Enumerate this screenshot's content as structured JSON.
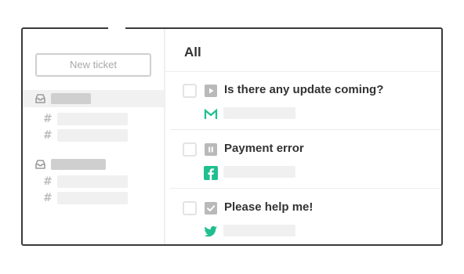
{
  "sidebar": {
    "new_ticket_label": "New ticket",
    "inboxes": [
      {
        "icon": "inbox-icon",
        "active": true,
        "channels": 2
      },
      {
        "icon": "inbox-icon",
        "active": false,
        "channels": 2
      }
    ]
  },
  "main": {
    "title": "All",
    "tickets": [
      {
        "subject": "Is there any update coming?",
        "status_icon": "play-icon",
        "channel_icon": "gmail-icon",
        "channel_color": "#1fbf8f"
      },
      {
        "subject": "Payment error",
        "status_icon": "pause-icon",
        "channel_icon": "facebook-icon",
        "channel_color": "#1fbf8f"
      },
      {
        "subject": "Please help me!",
        "status_icon": "check-icon",
        "channel_icon": "twitter-icon",
        "channel_color": "#1fbf8f"
      }
    ]
  },
  "colors": {
    "accent": "#1fbf8f",
    "frame": "#3a3a3a",
    "placeholder": "#f0f0f0",
    "status_icon_bg": "#b9b9b9"
  }
}
